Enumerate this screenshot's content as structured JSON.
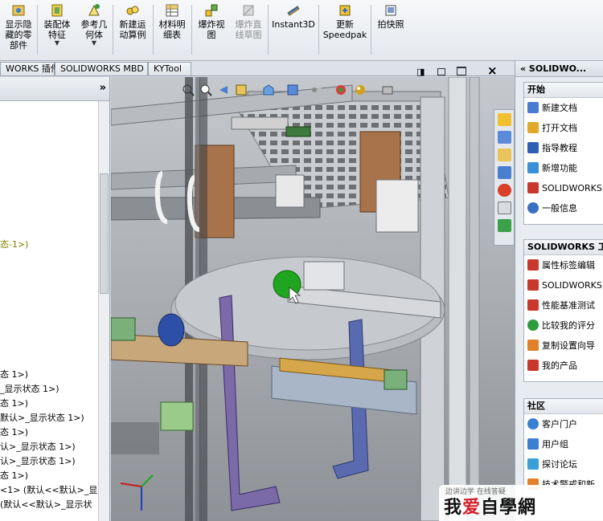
{
  "ribbon": {
    "buttons": [
      {
        "id": "show-hidden",
        "label": "显示隐\n藏的零\n部件"
      },
      {
        "id": "mate",
        "label": "装配体\n特征",
        "caret": "▼"
      },
      {
        "id": "ref-geom",
        "label": "参考几\n何体",
        "caret": "▼"
      },
      {
        "id": "new-motion",
        "label": "新建运\n动算例"
      },
      {
        "id": "bom",
        "label": "材料明\n细表"
      },
      {
        "id": "exploded",
        "label": "爆炸视\n图"
      },
      {
        "id": "explode-line",
        "label": "爆炸直\n线草图",
        "disabled": true
      },
      {
        "id": "instant3d",
        "label": "Instant3D"
      },
      {
        "id": "speedpak",
        "label": "更新\nSpeedpak"
      },
      {
        "id": "snapshot",
        "label": "拍快照"
      }
    ]
  },
  "tabs": [
    "WORKS 插件",
    "SOLIDWORKS MBD",
    "KYTool"
  ],
  "tree": {
    "chevron": "»",
    "lines": [
      {
        "text": "态-1>)",
        "olive": true
      },
      {
        "text": "态 1>)"
      },
      {
        "text": "_显示状态 1>)"
      },
      {
        "text": "态 1>)"
      },
      {
        "text": "默认>_显示状态 1>)"
      },
      {
        "text": "态 1>)"
      },
      {
        "text": "认>_显示状态 1>)"
      },
      {
        "text": "认>_显示状态 1>)"
      },
      {
        "text": "态 1>)"
      },
      {
        "text": "<1> (默认<<默认>_显"
      },
      {
        "text": "(默认<<默认>_显示状"
      }
    ]
  },
  "viewport": {
    "close": "×",
    "pin": "◨"
  },
  "taskpane": {
    "title": "« SOLIDWO...",
    "start": {
      "title": "开始",
      "items": [
        {
          "label": "新建文档",
          "color": "#4b7bd1"
        },
        {
          "label": "打开文档",
          "color": "#e0a92b"
        },
        {
          "label": "指导教程",
          "color": "#2f5fb3"
        },
        {
          "label": "新增功能",
          "color": "#3a8fd9"
        },
        {
          "label": "SOLIDWORKS",
          "color": "#c8382d"
        },
        {
          "label": "一般信息",
          "color": "#3b6fc1"
        }
      ]
    },
    "tools": {
      "title": "SOLIDWORKS 工",
      "items": [
        {
          "label": "属性标签编辑",
          "color": "#c8382d"
        },
        {
          "label": "SOLIDWORKS",
          "color": "#c8382d"
        },
        {
          "label": "性能基准测试",
          "color": "#c8382d"
        },
        {
          "label": "比较我的评分",
          "color": "#2e9b3d"
        },
        {
          "label": "复制设置向导",
          "color": "#e0802b"
        },
        {
          "label": "我的产品",
          "color": "#c8382d"
        }
      ]
    },
    "community": {
      "title": "社区",
      "items": [
        {
          "label": "客户门户",
          "color": "#3a7fd0"
        },
        {
          "label": "用户组",
          "color": "#3a7fd0"
        },
        {
          "label": "探讨论坛",
          "color": "#3a9fd9"
        },
        {
          "label": "技术警戒和新",
          "color": "#e0802b"
        }
      ]
    }
  },
  "watermark": {
    "top": "边讲边学  在线答疑",
    "prefix": "我",
    "accent": "爱",
    "suffix": "自學網"
  },
  "colors": {
    "accent_green": "#1fa51f",
    "frame_gray": "#b9bcc0"
  }
}
